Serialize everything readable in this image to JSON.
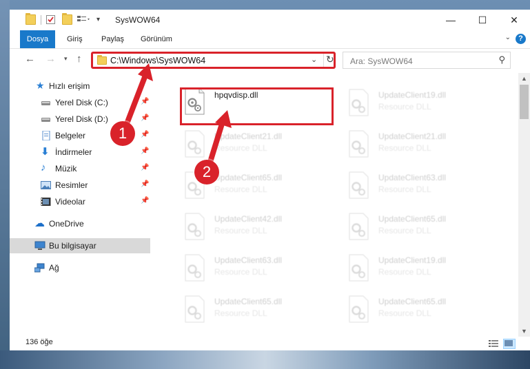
{
  "window": {
    "title": "SysWOW64",
    "controls": {
      "minimize": "—",
      "maximize": "☐",
      "close": "✕"
    }
  },
  "ribbon": {
    "tabs": [
      "Dosya",
      "Giriş",
      "Paylaş",
      "Görünüm"
    ],
    "help": "?",
    "collapse_chevron": "⌄"
  },
  "address": {
    "path": "C:\\Windows\\SysWOW64",
    "search_placeholder": "Ara: SysWOW64"
  },
  "nav": {
    "quick_access": "Hızlı erişim",
    "items": [
      {
        "label": "Yerel Disk (C:)",
        "icon": "drive-icon",
        "pinned": true
      },
      {
        "label": "Yerel Disk (D:)",
        "icon": "drive-icon",
        "pinned": true
      },
      {
        "label": "Belgeler",
        "icon": "documents-icon",
        "pinned": true
      },
      {
        "label": "İndirmeler",
        "icon": "downloads-icon",
        "pinned": true
      },
      {
        "label": "Müzik",
        "icon": "music-icon",
        "pinned": true
      },
      {
        "label": "Resimler",
        "icon": "pictures-icon",
        "pinned": true
      },
      {
        "label": "Videolar",
        "icon": "videos-icon",
        "pinned": true
      }
    ],
    "onedrive": "OneDrive",
    "this_pc": "Bu bilgisayar",
    "network": "Ağ"
  },
  "files": [
    {
      "name": "hpqvdisp.dll",
      "type": "",
      "highlighted": true
    },
    {
      "name": "UpdateClient19.dll",
      "type": "Resource DLL"
    },
    {
      "name": "UpdateClient21.dll",
      "type": "Resource DLL"
    },
    {
      "name": "UpdateClient21.dll",
      "type": "Resource DLL"
    },
    {
      "name": "UpdateClient65.dll",
      "type": "Resource DLL"
    },
    {
      "name": "UpdateClient63.dll",
      "type": "Resource DLL"
    },
    {
      "name": "UpdateClient42.dll",
      "type": "Resource DLL"
    },
    {
      "name": "UpdateClient65.dll",
      "type": "Resource DLL"
    },
    {
      "name": "UpdateClient63.dll",
      "type": "Resource DLL"
    },
    {
      "name": "UpdateClient19.dll",
      "type": "Resource DLL"
    },
    {
      "name": "UpdateClient65.dll",
      "type": "Resource DLL"
    },
    {
      "name": "UpdateClient65.dll",
      "type": "Resource DLL"
    }
  ],
  "status": {
    "item_count": "136 öğe"
  },
  "callouts": {
    "one": "1",
    "two": "2"
  },
  "colors": {
    "accent": "#1979ca",
    "highlight_red": "#d9222a",
    "selected_nav": "#d9d9d9"
  }
}
